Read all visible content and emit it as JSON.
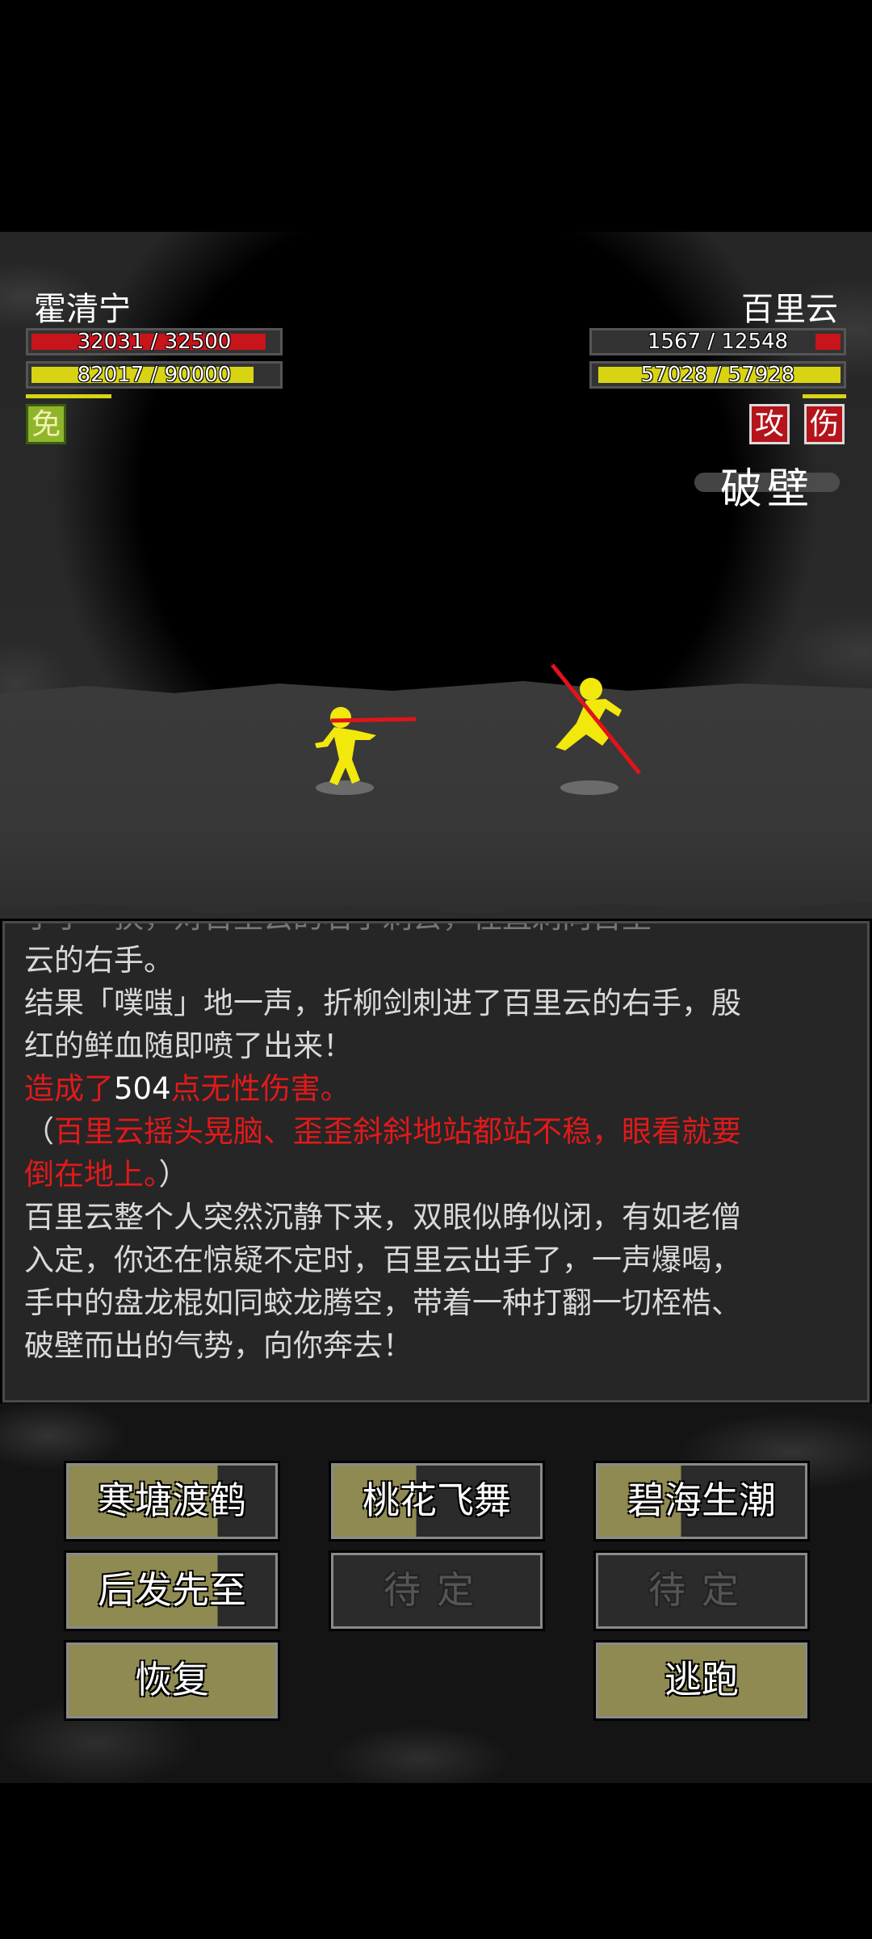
{
  "player": {
    "name": "霍清宁",
    "hp_text": "32031 / 32500",
    "hp_fraction": 0.985,
    "mp_text": "82017 / 90000",
    "mp_fraction": 0.911,
    "status": "免"
  },
  "enemy": {
    "name": "百里云",
    "hp_text": "1567 / 12548",
    "hp_fraction": 0.125,
    "mp_text": "57028 / 57928",
    "mp_fraction": 0.984,
    "status1": "攻",
    "status2": "伤",
    "skill_name": "破壁"
  },
  "log": {
    "l1": "云的右手。",
    "l2": "结果「噗嗤」地一声，折柳剑刺进了百里云的右手，殷",
    "l3": "红的鲜血随即喷了出来！",
    "l4a": "造成了",
    "l4b": "504",
    "l4c": "点无性伤害。",
    "l5a": "（",
    "l5b": "百里云摇头晃脑、歪歪斜斜地站都站不稳，眼看就要",
    "l6a": "倒在地上。",
    "l6b": "）",
    "l7": "百里云整个人突然沉静下来，双眼似睁似闭，有如老僧",
    "l8": "入定，你还在惊疑不定时，百里云出手了，一声爆喝，",
    "l9": "手中的盘龙棍如同蛟龙腾空，带着一种打翻一切桎梏、",
    "l10": "破壁而出的气势，向你奔去！"
  },
  "skills": {
    "s1": "寒塘渡鹤",
    "s2": "桃花飞舞",
    "s3": "碧海生潮",
    "s4": "后发先至",
    "s5": "待定",
    "s6": "待定",
    "s7": "恢复",
    "s8": "逃跑"
  },
  "colors": {
    "hp": "#c8141b",
    "mp": "#d8d414",
    "fighter": "#f2e80c",
    "weapon": "#e0141a",
    "log_red": "#e2191a",
    "skill_fill": "#8f8a52"
  }
}
